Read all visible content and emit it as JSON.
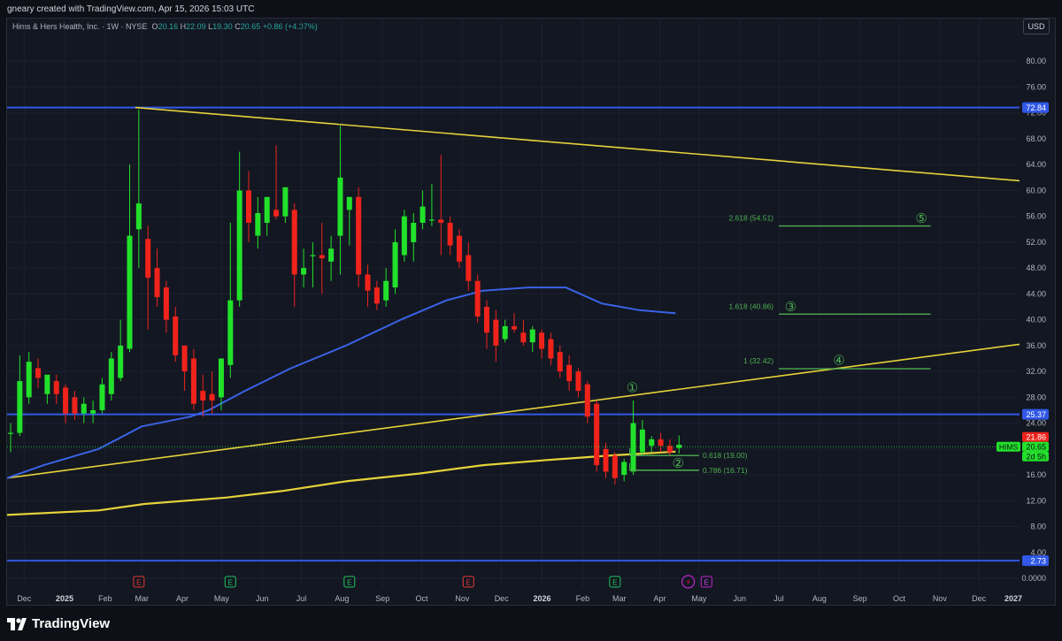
{
  "header": {
    "credit": "gneary created with TradingView.com, Apr 15, 2026 15:03 UTC",
    "symbol_title": "Hims & Hers Health, Inc. · 1W · NYSE",
    "o_label": "O",
    "o_value": "20.16",
    "h_label": "H",
    "h_value": "22.09",
    "l_label": "L",
    "l_value": "19.30",
    "c_label": "C",
    "c_value": "20.65",
    "change": "+0.86 (+4.37%)",
    "currency": "USD"
  },
  "footer": {
    "brand": "TradingView"
  },
  "colors": {
    "up": "#22e12b",
    "down": "#f0231b",
    "blue": "#3158e6",
    "yellow": "#e6d23a",
    "fib": "#4caf50",
    "ma": "#3a63e6"
  },
  "chart_data": {
    "type": "candlestick",
    "symbol": "HIMS",
    "interval": "1W",
    "y_ticks": [
      0,
      4,
      8,
      12,
      16,
      20,
      24,
      28,
      32,
      36,
      40,
      44,
      48,
      52,
      56,
      60,
      64,
      68,
      72,
      76,
      80
    ],
    "y_tick_labels": [
      "0.0000",
      "4.00",
      "8.00",
      "12.00",
      "16.00",
      "20.00",
      "24.00",
      "28.00",
      "32.00",
      "36.00",
      "40.00",
      "44.00",
      "48.00",
      "52.00",
      "56.00",
      "60.00",
      "64.00",
      "68.00",
      "72.00",
      "76.00",
      "80.00"
    ],
    "ylim": [
      -1.5,
      84
    ],
    "x_range": [
      "2024-11-18",
      "2027-01-01"
    ],
    "x_ticks": [
      {
        "label": "Dec",
        "date": "2024-12-01",
        "bold": false
      },
      {
        "label": "2025",
        "date": "2025-01-01",
        "bold": true
      },
      {
        "label": "Feb",
        "date": "2025-02-01",
        "bold": false
      },
      {
        "label": "Mar",
        "date": "2025-03-01",
        "bold": false
      },
      {
        "label": "Apr",
        "date": "2025-04-01",
        "bold": false
      },
      {
        "label": "May",
        "date": "2025-05-01",
        "bold": false
      },
      {
        "label": "Jun",
        "date": "2025-06-01",
        "bold": false
      },
      {
        "label": "Jul",
        "date": "2025-07-01",
        "bold": false
      },
      {
        "label": "Aug",
        "date": "2025-08-01",
        "bold": false
      },
      {
        "label": "Sep",
        "date": "2025-09-01",
        "bold": false
      },
      {
        "label": "Oct",
        "date": "2025-10-01",
        "bold": false
      },
      {
        "label": "Nov",
        "date": "2025-11-01",
        "bold": false
      },
      {
        "label": "Dec",
        "date": "2025-12-01",
        "bold": false
      },
      {
        "label": "2026",
        "date": "2026-01-01",
        "bold": true
      },
      {
        "label": "Feb",
        "date": "2026-02-01",
        "bold": false
      },
      {
        "label": "Mar",
        "date": "2026-03-01",
        "bold": false
      },
      {
        "label": "Apr",
        "date": "2026-04-01",
        "bold": false
      },
      {
        "label": "May",
        "date": "2026-05-01",
        "bold": false
      },
      {
        "label": "Jun",
        "date": "2026-06-01",
        "bold": false
      },
      {
        "label": "Jul",
        "date": "2026-07-01",
        "bold": false
      },
      {
        "label": "Aug",
        "date": "2026-08-01",
        "bold": false
      },
      {
        "label": "Sep",
        "date": "2026-09-01",
        "bold": false
      },
      {
        "label": "Oct",
        "date": "2026-10-01",
        "bold": false
      },
      {
        "label": "Nov",
        "date": "2026-11-01",
        "bold": false
      },
      {
        "label": "Dec",
        "date": "2026-12-01",
        "bold": false
      },
      {
        "label": "2027",
        "date": "2027-01-01",
        "bold": true
      }
    ],
    "candles": [
      {
        "t": "2024-11-18",
        "o": 22.5,
        "h": 24.0,
        "l": 19.5,
        "c": 22.5
      },
      {
        "t": "2024-11-25",
        "o": 22.5,
        "h": 34.5,
        "l": 22.0,
        "c": 30.5
      },
      {
        "t": "2024-12-02",
        "o": 28.0,
        "h": 35.0,
        "l": 27.0,
        "c": 33.5
      },
      {
        "t": "2024-12-09",
        "o": 32.5,
        "h": 34.0,
        "l": 29.5,
        "c": 31.0
      },
      {
        "t": "2024-12-16",
        "o": 28.5,
        "h": 31.0,
        "l": 27.0,
        "c": 31.5
      },
      {
        "t": "2024-12-23",
        "o": 30.5,
        "h": 31.5,
        "l": 27.0,
        "c": 28.5
      },
      {
        "t": "2024-12-30",
        "o": 29.5,
        "h": 30.0,
        "l": 24.0,
        "c": 25.5
      },
      {
        "t": "2025-01-06",
        "o": 28.0,
        "h": 29.0,
        "l": 24.5,
        "c": 25.5
      },
      {
        "t": "2025-01-13",
        "o": 25.5,
        "h": 28.0,
        "l": 24.0,
        "c": 27.0
      },
      {
        "t": "2025-01-20",
        "o": 25.5,
        "h": 27.5,
        "l": 24.0,
        "c": 26.0
      },
      {
        "t": "2025-01-27",
        "o": 26.0,
        "h": 31.0,
        "l": 25.5,
        "c": 30.0
      },
      {
        "t": "2025-02-03",
        "o": 28.5,
        "h": 35.0,
        "l": 27.5,
        "c": 34.0
      },
      {
        "t": "2025-02-10",
        "o": 31.0,
        "h": 40.0,
        "l": 30.5,
        "c": 36.0
      },
      {
        "t": "2025-02-17",
        "o": 35.5,
        "h": 64.0,
        "l": 35.0,
        "c": 53.0
      },
      {
        "t": "2025-02-24",
        "o": 54.0,
        "h": 72.5,
        "l": 48.0,
        "c": 58.0
      },
      {
        "t": "2025-03-03",
        "o": 52.5,
        "h": 54.5,
        "l": 38.5,
        "c": 46.5
      },
      {
        "t": "2025-03-10",
        "o": 48.0,
        "h": 51.0,
        "l": 42.0,
        "c": 43.5
      },
      {
        "t": "2025-03-17",
        "o": 45.0,
        "h": 46.0,
        "l": 38.0,
        "c": 40.0
      },
      {
        "t": "2025-03-24",
        "o": 40.5,
        "h": 42.0,
        "l": 33.5,
        "c": 34.5
      },
      {
        "t": "2025-03-31",
        "o": 36.0,
        "h": 36.0,
        "l": 29.0,
        "c": 32.0
      },
      {
        "t": "2025-04-07",
        "o": 34.0,
        "h": 35.5,
        "l": 26.0,
        "c": 27.0
      },
      {
        "t": "2025-04-14",
        "o": 29.0,
        "h": 31.5,
        "l": 25.0,
        "c": 27.5
      },
      {
        "t": "2025-04-21",
        "o": 28.5,
        "h": 32.0,
        "l": 25.5,
        "c": 27.5
      },
      {
        "t": "2025-04-28",
        "o": 28.0,
        "h": 33.5,
        "l": 26.0,
        "c": 34.0
      },
      {
        "t": "2025-05-05",
        "o": 33.0,
        "h": 55.0,
        "l": 31.0,
        "c": 43.0
      },
      {
        "t": "2025-05-12",
        "o": 43.0,
        "h": 66.0,
        "l": 42.0,
        "c": 60.0
      },
      {
        "t": "2025-05-19",
        "o": 60.0,
        "h": 63.0,
        "l": 52.0,
        "c": 55.0
      },
      {
        "t": "2025-05-26",
        "o": 53.0,
        "h": 59.0,
        "l": 51.0,
        "c": 56.5
      },
      {
        "t": "2025-06-02",
        "o": 55.0,
        "h": 58.0,
        "l": 53.0,
        "c": 59.0
      },
      {
        "t": "2025-06-09",
        "o": 57.0,
        "h": 67.0,
        "l": 55.5,
        "c": 56.0
      },
      {
        "t": "2025-06-16",
        "o": 56.0,
        "h": 60.0,
        "l": 55.0,
        "c": 60.5
      },
      {
        "t": "2025-06-23",
        "o": 57.0,
        "h": 58.0,
        "l": 42.0,
        "c": 47.0
      },
      {
        "t": "2025-06-30",
        "o": 47.0,
        "h": 51.0,
        "l": 45.0,
        "c": 48.0
      },
      {
        "t": "2025-07-07",
        "o": 50.0,
        "h": 52.0,
        "l": 45.0,
        "c": 50.0
      },
      {
        "t": "2025-07-14",
        "o": 50.0,
        "h": 55.0,
        "l": 44.0,
        "c": 49.5
      },
      {
        "t": "2025-07-21",
        "o": 49.0,
        "h": 53.0,
        "l": 46.0,
        "c": 51.0
      },
      {
        "t": "2025-07-28",
        "o": 53.0,
        "h": 70.0,
        "l": 47.0,
        "c": 62.0
      },
      {
        "t": "2025-08-04",
        "o": 57.0,
        "h": 58.0,
        "l": 51.5,
        "c": 59.0
      },
      {
        "t": "2025-08-11",
        "o": 59.0,
        "h": 60.5,
        "l": 45.0,
        "c": 47.0
      },
      {
        "t": "2025-08-18",
        "o": 47.0,
        "h": 48.5,
        "l": 42.0,
        "c": 44.5
      },
      {
        "t": "2025-08-25",
        "o": 45.0,
        "h": 46.0,
        "l": 41.5,
        "c": 42.5
      },
      {
        "t": "2025-09-01",
        "o": 43.0,
        "h": 48.0,
        "l": 42.0,
        "c": 46.0
      },
      {
        "t": "2025-09-08",
        "o": 45.0,
        "h": 54.0,
        "l": 44.0,
        "c": 52.0
      },
      {
        "t": "2025-09-15",
        "o": 50.0,
        "h": 57.0,
        "l": 49.0,
        "c": 56.0
      },
      {
        "t": "2025-09-22",
        "o": 52.0,
        "h": 56.5,
        "l": 49.0,
        "c": 55.0
      },
      {
        "t": "2025-09-29",
        "o": 55.0,
        "h": 60.0,
        "l": 54.0,
        "c": 57.5
      },
      {
        "t": "2025-10-06",
        "o": 55.5,
        "h": 61.0,
        "l": 54.5,
        "c": 55.5
      },
      {
        "t": "2025-10-13",
        "o": 55.5,
        "h": 65.5,
        "l": 50.0,
        "c": 55.0
      },
      {
        "t": "2025-10-20",
        "o": 55.0,
        "h": 56.0,
        "l": 50.0,
        "c": 51.5
      },
      {
        "t": "2025-10-27",
        "o": 53.0,
        "h": 54.0,
        "l": 48.0,
        "c": 49.0
      },
      {
        "t": "2025-11-03",
        "o": 50.0,
        "h": 52.0,
        "l": 44.5,
        "c": 46.0
      },
      {
        "t": "2025-11-10",
        "o": 46.0,
        "h": 47.0,
        "l": 39.5,
        "c": 40.5
      },
      {
        "t": "2025-11-17",
        "o": 42.0,
        "h": 43.0,
        "l": 35.5,
        "c": 38.0
      },
      {
        "t": "2025-11-24",
        "o": 40.0,
        "h": 41.5,
        "l": 33.5,
        "c": 36.0
      },
      {
        "t": "2025-12-01",
        "o": 37.0,
        "h": 40.0,
        "l": 36.5,
        "c": 39.0
      },
      {
        "t": "2025-12-08",
        "o": 39.0,
        "h": 41.0,
        "l": 38.0,
        "c": 38.5
      },
      {
        "t": "2025-12-15",
        "o": 38.0,
        "h": 40.0,
        "l": 36.0,
        "c": 36.5
      },
      {
        "t": "2025-12-22",
        "o": 36.5,
        "h": 39.0,
        "l": 35.0,
        "c": 38.5
      },
      {
        "t": "2025-12-29",
        "o": 38.0,
        "h": 38.5,
        "l": 34.0,
        "c": 35.5
      },
      {
        "t": "2026-01-05",
        "o": 37.0,
        "h": 38.0,
        "l": 33.0,
        "c": 34.0
      },
      {
        "t": "2026-01-12",
        "o": 35.0,
        "h": 36.0,
        "l": 31.0,
        "c": 32.0
      },
      {
        "t": "2026-01-19",
        "o": 33.0,
        "h": 34.5,
        "l": 29.0,
        "c": 30.5
      },
      {
        "t": "2026-01-26",
        "o": 32.0,
        "h": 32.5,
        "l": 28.0,
        "c": 29.0
      },
      {
        "t": "2026-02-02",
        "o": 30.0,
        "h": 30.5,
        "l": 24.0,
        "c": 25.0
      },
      {
        "t": "2026-02-09",
        "o": 27.0,
        "h": 27.5,
        "l": 16.5,
        "c": 17.5
      },
      {
        "t": "2026-02-16",
        "o": 20.0,
        "h": 21.0,
        "l": 15.5,
        "c": 16.5
      },
      {
        "t": "2026-02-23",
        "o": 19.0,
        "h": 19.5,
        "l": 14.5,
        "c": 15.5
      },
      {
        "t": "2026-03-02",
        "o": 16.0,
        "h": 18.5,
        "l": 15.0,
        "c": 18.0
      },
      {
        "t": "2026-03-09",
        "o": 16.5,
        "h": 27.5,
        "l": 16.0,
        "c": 24.0
      },
      {
        "t": "2026-03-16",
        "o": 19.5,
        "h": 24.5,
        "l": 19.0,
        "c": 23.0
      },
      {
        "t": "2026-03-23",
        "o": 20.5,
        "h": 22.0,
        "l": 19.5,
        "c": 21.5
      },
      {
        "t": "2026-03-30",
        "o": 21.5,
        "h": 22.5,
        "l": 19.5,
        "c": 20.5
      },
      {
        "t": "2026-04-06",
        "o": 20.5,
        "h": 21.5,
        "l": 19.0,
        "c": 19.5
      },
      {
        "t": "2026-04-13",
        "o": 20.16,
        "h": 22.09,
        "l": 19.3,
        "c": 20.65
      }
    ],
    "ma_blue": [
      {
        "t": "2024-11-18",
        "v": 15.5
      },
      {
        "t": "2024-12-16",
        "v": 17.5
      },
      {
        "t": "2025-01-27",
        "v": 20.0
      },
      {
        "t": "2025-03-01",
        "v": 23.5
      },
      {
        "t": "2025-04-07",
        "v": 25.0
      },
      {
        "t": "2025-04-21",
        "v": 26.0
      },
      {
        "t": "2025-05-19",
        "v": 29.0
      },
      {
        "t": "2025-06-23",
        "v": 32.5
      },
      {
        "t": "2025-08-04",
        "v": 36.0
      },
      {
        "t": "2025-09-15",
        "v": 40.0
      },
      {
        "t": "2025-10-20",
        "v": 43.0
      },
      {
        "t": "2025-11-17",
        "v": 44.5
      },
      {
        "t": "2025-12-22",
        "v": 45.0
      },
      {
        "t": "2026-01-19",
        "v": 45.0
      },
      {
        "t": "2026-02-16",
        "v": 42.5
      },
      {
        "t": "2026-03-16",
        "v": 41.5
      },
      {
        "t": "2026-04-13",
        "v": 41.0
      }
    ],
    "ma_yellow": [
      {
        "t": "2024-11-18",
        "v": 9.8
      },
      {
        "t": "2025-01-27",
        "v": 10.5
      },
      {
        "t": "2025-03-03",
        "v": 11.5
      },
      {
        "t": "2025-05-05",
        "v": 12.5
      },
      {
        "t": "2025-06-16",
        "v": 13.5
      },
      {
        "t": "2025-08-04",
        "v": 15.0
      },
      {
        "t": "2025-09-29",
        "v": 16.2
      },
      {
        "t": "2025-11-17",
        "v": 17.5
      },
      {
        "t": "2026-01-05",
        "v": 18.3
      },
      {
        "t": "2026-02-23",
        "v": 19.0
      },
      {
        "t": "2026-04-13",
        "v": 19.6
      }
    ],
    "horizontal_lines": [
      {
        "price": 72.84,
        "label": "72.84",
        "color": "#3158e6"
      },
      {
        "price": 25.37,
        "label": "25.37",
        "color": "#3158e6"
      },
      {
        "price": 2.73,
        "label": "2.73",
        "color": "#3158e6"
      }
    ],
    "trendlines": [
      {
        "name": "upper-trendline",
        "from": {
          "t": "2025-02-24",
          "v": 72.84
        },
        "to": {
          "t": "2027-01-01",
          "v": 61.5
        }
      },
      {
        "name": "lower-trendline",
        "from": {
          "t": "2024-11-18",
          "v": 15.5
        },
        "to": {
          "t": "2027-01-01",
          "v": 36.2
        }
      }
    ],
    "fib_levels": [
      {
        "label": "2.618 (54.51)",
        "price": 54.51,
        "from": "2026-07-01",
        "to": "2026-10-25"
      },
      {
        "label": "1.618 (40.86)",
        "price": 40.86,
        "from": "2026-07-01",
        "to": "2026-10-25"
      },
      {
        "label": "1 (32.42)",
        "price": 32.42,
        "from": "2026-07-01",
        "to": "2026-10-25"
      },
      {
        "label": "0.618 (19.00)",
        "price": 19.0,
        "from": "2026-03-09",
        "to": "2026-05-01"
      },
      {
        "label": "0.786 (16.71)",
        "price": 16.71,
        "from": "2026-03-09",
        "to": "2026-05-01"
      }
    ],
    "wave_labels": [
      {
        "text": "①",
        "t": "2026-03-11",
        "v": 29.5
      },
      {
        "text": "②",
        "t": "2026-04-15",
        "v": 17.8
      },
      {
        "text": "③",
        "t": "2026-07-10",
        "v": 42.0
      },
      {
        "text": "④",
        "t": "2026-08-16",
        "v": 33.7
      },
      {
        "text": "⑤",
        "t": "2026-10-18",
        "v": 55.7
      }
    ],
    "price_tags": [
      {
        "text": "21.86",
        "price": 21.86,
        "color": "#f0231b"
      },
      {
        "text": "20.65",
        "price": 20.65,
        "color": "#22e12b"
      },
      {
        "text": "2d 5h",
        "price": 19.3,
        "color": "#22e12b"
      }
    ],
    "symbol_tag": {
      "text": "HIMS",
      "price": 20.65
    },
    "events": [
      {
        "text": "E",
        "t": "2025-02-24",
        "type": "earnings-past-red"
      },
      {
        "text": "E",
        "t": "2025-05-05",
        "type": "earnings-green"
      },
      {
        "text": "E",
        "t": "2025-08-04",
        "type": "earnings-green"
      },
      {
        "text": "E",
        "t": "2025-11-03",
        "type": "earnings-past-red"
      },
      {
        "text": "E",
        "t": "2026-02-23",
        "type": "earnings-green"
      },
      {
        "text": "⚡",
        "t": "2026-04-20",
        "type": "split"
      },
      {
        "text": "E",
        "t": "2026-05-04",
        "type": "earnings-upcoming"
      }
    ]
  }
}
